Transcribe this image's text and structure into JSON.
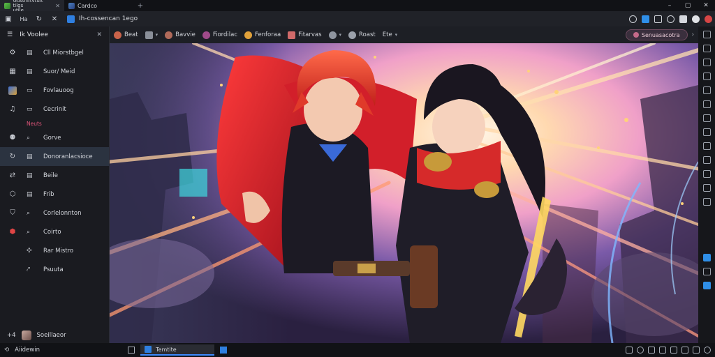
{
  "browser": {
    "tabs": [
      {
        "title_line1": "Gusonitvtuit tilgs",
        "title_line2": "utile",
        "active": true
      },
      {
        "title": "Cardco",
        "active": false
      }
    ],
    "address": "Ih-cossencan 1ego",
    "window_controls": [
      "–",
      "▢",
      "✕"
    ]
  },
  "sidebar": {
    "title": "Ik Voolee",
    "items": [
      {
        "label": "Cll Miorstbgel"
      },
      {
        "label": "Suor/ Meid"
      },
      {
        "label": "Fovlauoog"
      },
      {
        "label": "Cecrinit"
      },
      {
        "label": "Neuts",
        "sub": true
      },
      {
        "label": "Gorve"
      },
      {
        "label": "Donoranlacsioce",
        "active": true
      },
      {
        "label": "Beile"
      },
      {
        "label": "Frib"
      },
      {
        "label": "Corlelonnton"
      },
      {
        "label": "Coirto"
      },
      {
        "label": "Rar Mistro"
      },
      {
        "label": "Psuuta"
      }
    ],
    "footer_label": "Soeillaeor",
    "footer_count": "+4"
  },
  "bookmarks": [
    {
      "label": "Beat",
      "color": "#c9634a"
    },
    {
      "label": "",
      "color": "#8a8f99",
      "caret": true
    },
    {
      "label": "Bavvie",
      "color": "#b06a5a"
    },
    {
      "label": "Fiordilac",
      "color": "#a04a8a"
    },
    {
      "label": "Fenforaa",
      "color": "#e0a13a"
    },
    {
      "label": "Fitarvas",
      "color": "#d06a6a"
    },
    {
      "label": "",
      "color": "#8f95a0",
      "caret": true
    },
    {
      "label": "Roast",
      "color": "#9aa0aa"
    },
    {
      "label": "Ete",
      "color": "#9aa0aa",
      "caret": true
    }
  ],
  "bookmark_pill": {
    "label": "Senuasacotra"
  },
  "taskbar": {
    "start_label": "Aiidewin",
    "task_label": "Temtite"
  },
  "colors": {
    "accent": "#3d8bff",
    "active_sidebar": "#2b3340",
    "sub_text": "#e0557a"
  }
}
